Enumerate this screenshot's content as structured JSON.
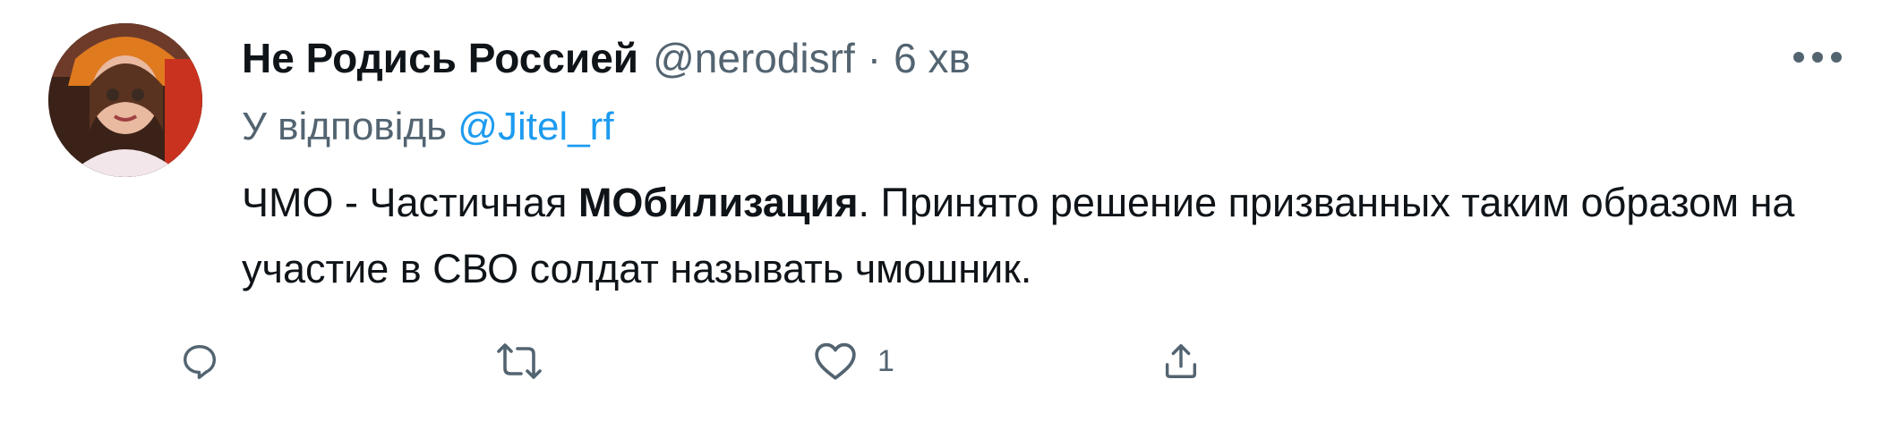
{
  "tweet": {
    "author_name": "Не Родись Россией",
    "handle": "@nerodisrf",
    "separator": "·",
    "time": "6 хв",
    "reply_prefix": "У відповідь",
    "reply_mention": "@Jitel_rf",
    "text_part1": "ЧМО - Частичная ",
    "text_bold": "МОбилизация",
    "text_part2": ". Принято решение призванных таким образом на участие в СВО солдат называть чмошник."
  },
  "actions": {
    "reply_icon": "reply-icon",
    "retweet_icon": "retweet-icon",
    "like_icon": "heart-icon",
    "like_count": "1",
    "share_icon": "share-icon"
  },
  "colors": {
    "text": "#0f1419",
    "secondary": "#536471",
    "link": "#1d9bf0"
  }
}
